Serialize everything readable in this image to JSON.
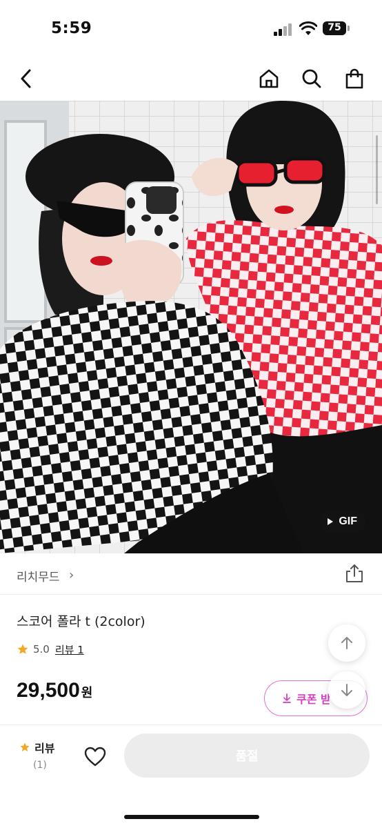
{
  "status_bar": {
    "time": "5:59",
    "battery": "75"
  },
  "nav": {
    "back_icon": "chevron-left-icon",
    "home_icon": "home-icon",
    "search_icon": "search-icon",
    "cart_icon": "shopping-bag-icon"
  },
  "hero": {
    "badge": "GIF"
  },
  "brand": {
    "name": "리치무드",
    "chevron": "›"
  },
  "product": {
    "name": "스코어 폴라 t (2color)",
    "rating": "5.0",
    "review_label": "리뷰 1",
    "price": "29,500",
    "currency": "원"
  },
  "coupon": {
    "label": "쿠폰 받"
  },
  "bottom_bar": {
    "review_label": "리뷰",
    "review_count": "(1)",
    "soldout_label": "품절"
  },
  "colors": {
    "accent": "#d63dc4",
    "star": "#f5a623",
    "disabled": "#ececec"
  }
}
